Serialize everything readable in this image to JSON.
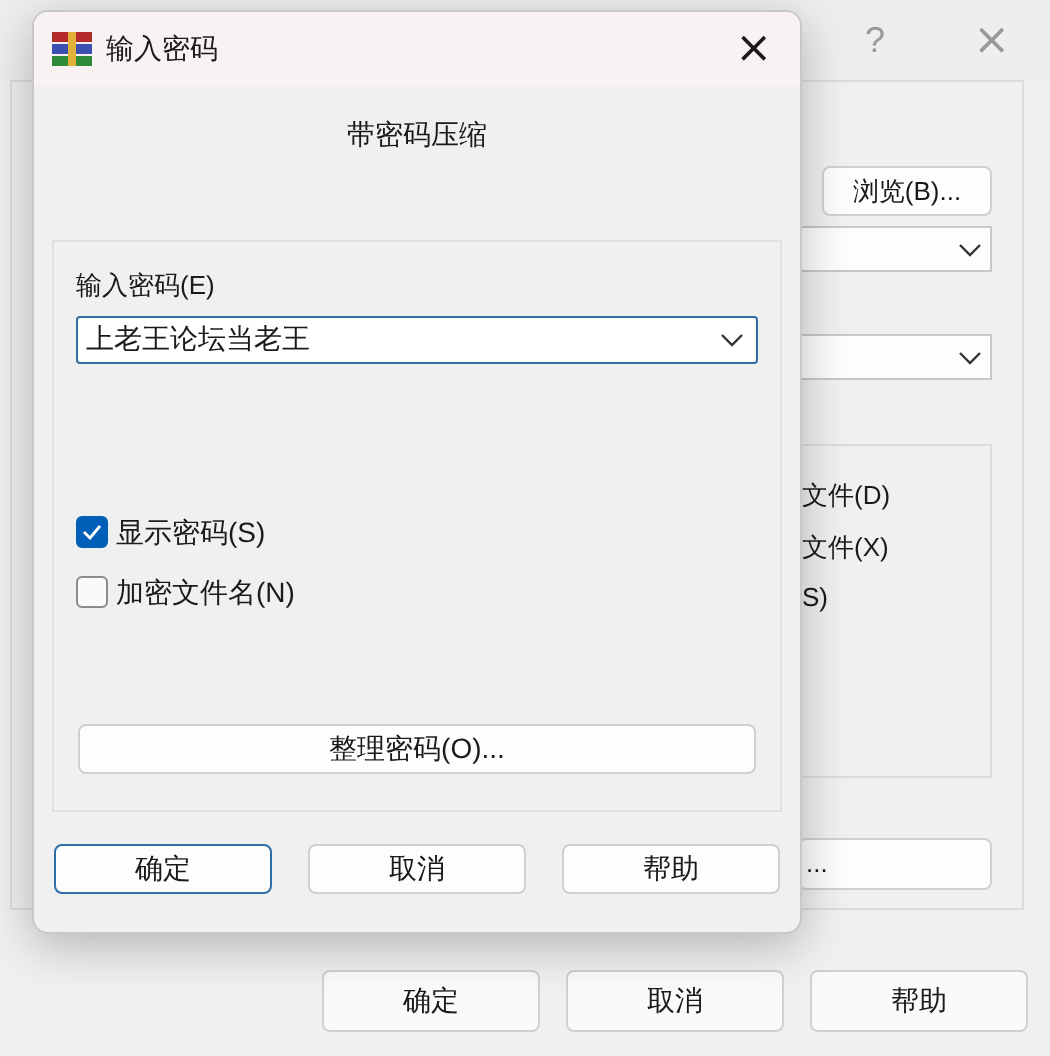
{
  "background_window": {
    "title_buttons": [
      "?",
      "×"
    ],
    "browse_button": "浏览(B)...",
    "options_partial": [
      "文件(D)",
      "文件(X)",
      "S)"
    ],
    "ellipsis_button": "...",
    "buttons": [
      "确定",
      "取消",
      "帮助"
    ]
  },
  "dialog": {
    "title": "输入密码",
    "close": "×",
    "heading": "带密码压缩",
    "password_label": "输入密码(E)",
    "password_value": "上老王论坛当老王",
    "checkboxes": [
      {
        "label": "显示密码(S)",
        "checked": true
      },
      {
        "label": "加密文件名(N)",
        "checked": false
      }
    ],
    "organize_button": "整理密码(O)...",
    "buttons": [
      {
        "label": "确定",
        "default": true
      },
      {
        "label": "取消",
        "default": false
      },
      {
        "label": "帮助",
        "default": false
      }
    ]
  }
}
